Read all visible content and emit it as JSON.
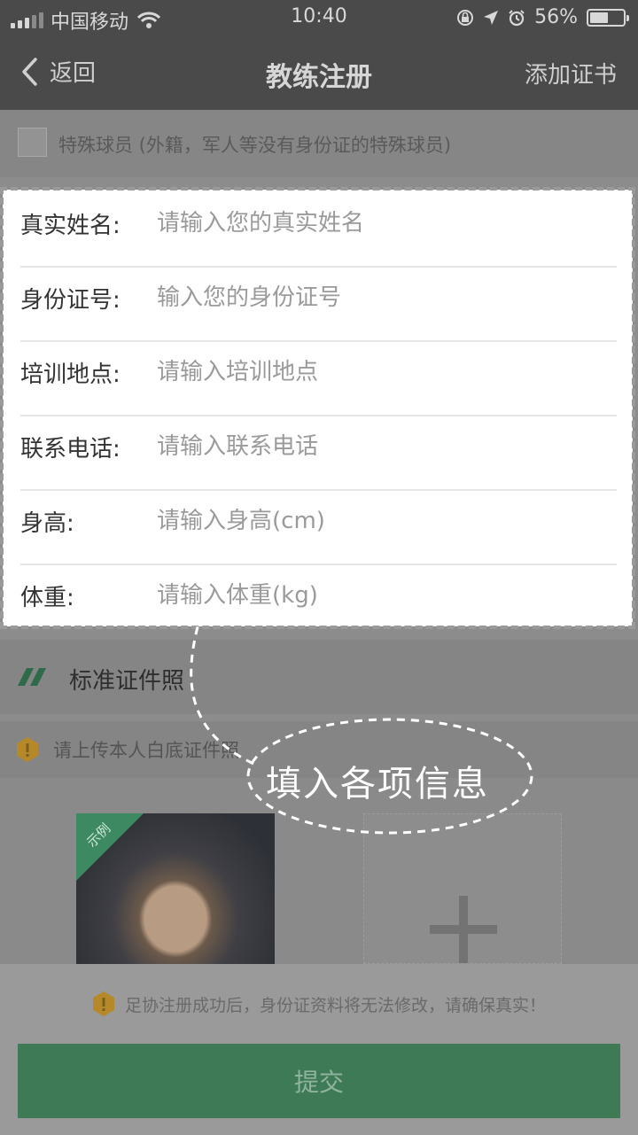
{
  "status_bar": {
    "carrier": "中国移动",
    "time": "10:40",
    "battery": "56%",
    "battery_level": 0.56,
    "icons": [
      "signal-icon",
      "wifi-icon",
      "lock-rotation-icon",
      "location-icon",
      "alarm-icon",
      "battery-icon"
    ]
  },
  "nav": {
    "back_label": "返回",
    "title": "教练注册",
    "action_label": "添加证书"
  },
  "special": {
    "label": "特殊球员 (外籍，军人等没有身份证的特殊球员)",
    "checked": false
  },
  "form": {
    "fields": [
      {
        "label": "真实姓名:",
        "placeholder": "请输入您的真实姓名",
        "value": ""
      },
      {
        "label": "身份证号:",
        "placeholder": "输入您的身份证号",
        "value": ""
      },
      {
        "label": "培训地点:",
        "placeholder": "请输入培训地点",
        "value": ""
      },
      {
        "label": "联系电话:",
        "placeholder": "请输入联系电话",
        "value": ""
      },
      {
        "label": "身高:",
        "placeholder": "请输入身高(cm)",
        "value": ""
      },
      {
        "label": "体重:",
        "placeholder": "请输入体重(kg)",
        "value": ""
      }
    ]
  },
  "photo_section": {
    "title": "标准证件照",
    "notice": "请上传本人白底证件照",
    "sample_tag": "示例"
  },
  "footer": {
    "warning": "足协注册成功后，身份证资料将无法修改，请确保真实！",
    "submit_label": "提交"
  },
  "annotation": {
    "bubble_text": "填入各项信息"
  },
  "colors": {
    "accent_green": "#3f7a56",
    "warning_amber": "#d9a21a",
    "nav_bg": "#4a4a4a"
  }
}
